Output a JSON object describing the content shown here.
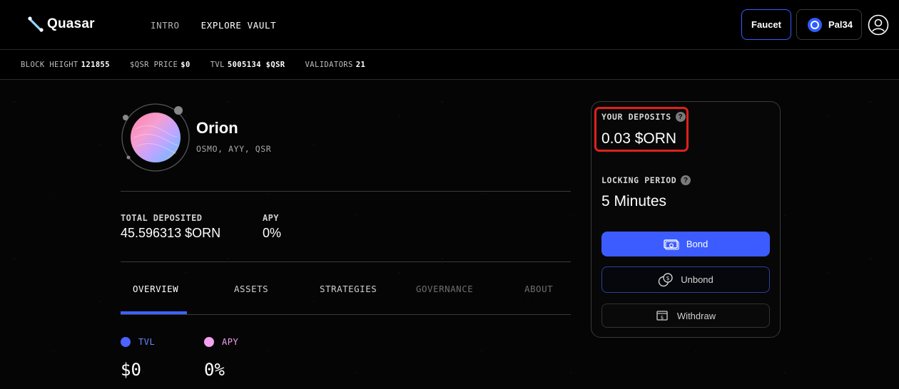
{
  "header": {
    "brand": "Quasar",
    "nav": [
      {
        "label": "INTRO",
        "active": false
      },
      {
        "label": "EXPLORE VAULT",
        "active": true
      }
    ],
    "faucet_label": "Faucet",
    "wallet_label": "Pal34"
  },
  "stats": [
    {
      "label": "BLOCK HEIGHT",
      "value": "121855"
    },
    {
      "label": "$QSR PRICE",
      "value": "$0"
    },
    {
      "label": "TVL",
      "value": "5005134 $QSR"
    },
    {
      "label": "VALIDATORS",
      "value": "21"
    }
  ],
  "vault": {
    "name": "Orion",
    "tokens": "OSMO, AYY, QSR",
    "total_deposited_label": "TOTAL DEPOSITED",
    "total_deposited_value": "45.596313 $ORN",
    "apy_label": "APY",
    "apy_value": "0%"
  },
  "tabs": [
    {
      "label": "OVERVIEW",
      "state": "active"
    },
    {
      "label": "ASSETS",
      "state": "normal"
    },
    {
      "label": "STRATEGIES",
      "state": "normal"
    },
    {
      "label": "GOVERNANCE",
      "state": "disabled"
    },
    {
      "label": "ABOUT",
      "state": "disabled"
    }
  ],
  "overview": {
    "legend": [
      {
        "label": "TVL",
        "value": "$0",
        "color": "#4b63ff"
      },
      {
        "label": "APY",
        "value": "0%",
        "color": "#f2a1ef"
      }
    ]
  },
  "card": {
    "deposits_label": "YOUR DEPOSITS",
    "deposits_value": "0.03 $ORN",
    "locking_label": "LOCKING PERIOD",
    "locking_value": "5 Minutes",
    "help_glyph": "?",
    "bond_label": "Bond",
    "unbond_label": "Unbond",
    "withdraw_label": "Withdraw"
  },
  "colors": {
    "accent": "#3c5cff",
    "highlight": "#e0201b",
    "background": "#050505"
  }
}
